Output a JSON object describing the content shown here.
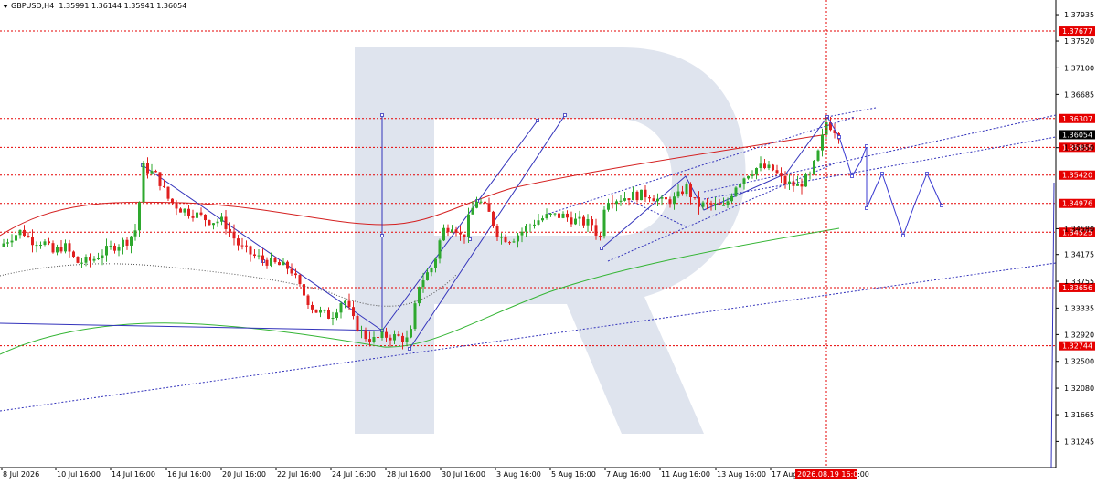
{
  "header": {
    "symbol": "GBPUSD,H4",
    "ohlc": "1.35991 1.36144 1.35941 1.36054"
  },
  "colors": {
    "background": "#ffffff",
    "bull": "#2ea82e",
    "bear": "#e02020",
    "level_line": "#e60000",
    "level_box": "#e60000",
    "current_box": "#000000",
    "ma_red": "#d42020",
    "ma_green": "#35b535",
    "trend_blue": "#3333bb",
    "forecast_blue": "#3a3ad0",
    "watermark": "#dfe4ee",
    "time_marker": "#e60000"
  },
  "chart_data": {
    "type": "candlestick",
    "title": "GBPUSD,H4",
    "ylim": [
      1.3095,
      1.3805
    ],
    "y_ticks": [
      "1.37935",
      "1.37520",
      "1.37100",
      "1.36685",
      "1.35850",
      "1.34580",
      "1.34175",
      "1.33755",
      "1.33335",
      "1.32920",
      "1.32500",
      "1.32080",
      "1.31665",
      "1.31245"
    ],
    "price_levels": [
      "1.37677",
      "1.36307",
      "1.35855",
      "1.35420",
      "1.34976",
      "1.34525",
      "1.33656",
      "1.32744"
    ],
    "current_price": "1.36054",
    "x_labels": [
      "8 Jul 2026",
      "10 Jul 16:00",
      "14 Jul 16:00",
      "16 Jul 16:00",
      "20 Jul 16:00",
      "22 Jul 16:00",
      "24 Jul 16:00",
      "28 Jul 16:00",
      "30 Jul 16:00",
      "3 Aug 16:00",
      "5 Aug 16:00",
      "7 Aug 16:00",
      "11 Aug 16:00",
      "13 Aug 16:00",
      "17 Aug"
    ],
    "time_marker_label": "2026.08.19 16:00",
    "time_marker_suffix": ":00",
    "key_prices": [
      {
        "point": "start",
        "price": 1.343
      },
      {
        "point": "high_jul14",
        "price": 1.356
      },
      {
        "point": "low_jul27",
        "price": 1.3274
      },
      {
        "point": "high_aug19",
        "price": 1.3634
      },
      {
        "point": "last",
        "price": 1.36054
      }
    ],
    "indicators": [
      {
        "name": "moving_average_red"
      },
      {
        "name": "moving_average_green"
      },
      {
        "name": "moving_average_dotted"
      }
    ],
    "grid": false,
    "legend": "none"
  }
}
